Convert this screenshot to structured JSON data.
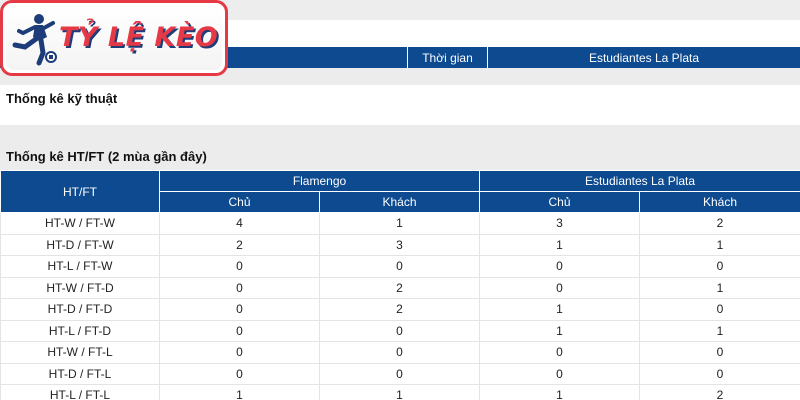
{
  "brand": {
    "logo_text": "TỶ LỆ KÈO",
    "logo_color": "#e53945",
    "logo_shadow": "#1d3d7a"
  },
  "timeline_header": {
    "home": "Flamengo",
    "time": "Thời gian",
    "away": "Estudiantes La Plata"
  },
  "technical": {
    "title": "Thống kê kỹ thuật"
  },
  "htft": {
    "title": "Thống kê HT/FT (2 mùa gần đây)",
    "col_label": "HT/FT",
    "home_team": "Flamengo",
    "away_team": "Estudiantes La Plata",
    "sub_headers": [
      "Chủ",
      "Khách",
      "Chủ",
      "Khách"
    ],
    "rows": [
      {
        "label": "HT-W / FT-W",
        "values": [
          "4",
          "1",
          "3",
          "2"
        ]
      },
      {
        "label": "HT-D / FT-W",
        "values": [
          "2",
          "3",
          "1",
          "1"
        ]
      },
      {
        "label": "HT-L / FT-W",
        "values": [
          "0",
          "0",
          "0",
          "0"
        ]
      },
      {
        "label": "HT-W / FT-D",
        "values": [
          "0",
          "2",
          "0",
          "1"
        ]
      },
      {
        "label": "HT-D / FT-D",
        "values": [
          "0",
          "2",
          "1",
          "0"
        ]
      },
      {
        "label": "HT-L / FT-D",
        "values": [
          "0",
          "0",
          "1",
          "1"
        ]
      },
      {
        "label": "HT-W / FT-L",
        "values": [
          "0",
          "0",
          "0",
          "0"
        ]
      },
      {
        "label": "HT-D / FT-L",
        "values": [
          "0",
          "0",
          "0",
          "0"
        ]
      },
      {
        "label": "HT-L / FT-L",
        "values": [
          "1",
          "1",
          "1",
          "2"
        ]
      }
    ]
  },
  "colors": {
    "header_blue": "#0d4a8f",
    "band_gray": "#ececec"
  }
}
